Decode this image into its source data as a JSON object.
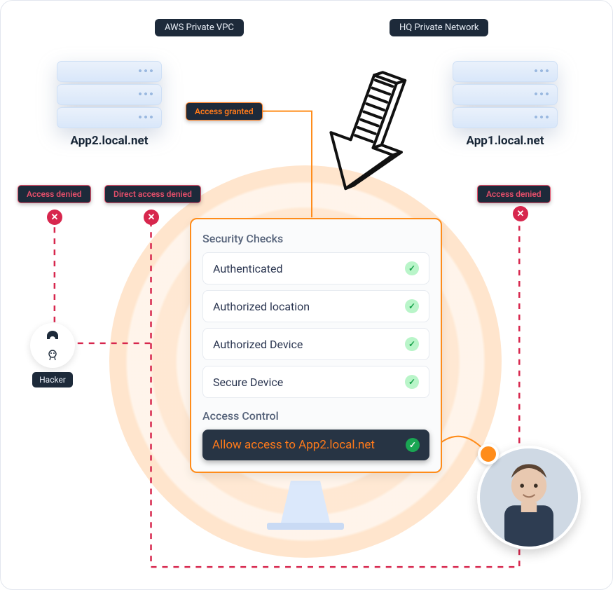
{
  "zones": {
    "vpc": "AWS Private VPC",
    "hq": "HQ Private Network"
  },
  "servers": {
    "left": "App2.local.net",
    "right": "App1.local.net"
  },
  "chips": {
    "granted": "Access granted",
    "denied_left": "Access denied",
    "direct_denied": "Direct access denied",
    "denied_right": "Access denied"
  },
  "card": {
    "security_title": "Security Checks",
    "checks": [
      "Authenticated",
      "Authorized location",
      "Authorized Device",
      "Secure Device"
    ],
    "access_title": "Access Control",
    "allow": "Allow access to App2.local.net"
  },
  "hacker_label": "Hacker"
}
